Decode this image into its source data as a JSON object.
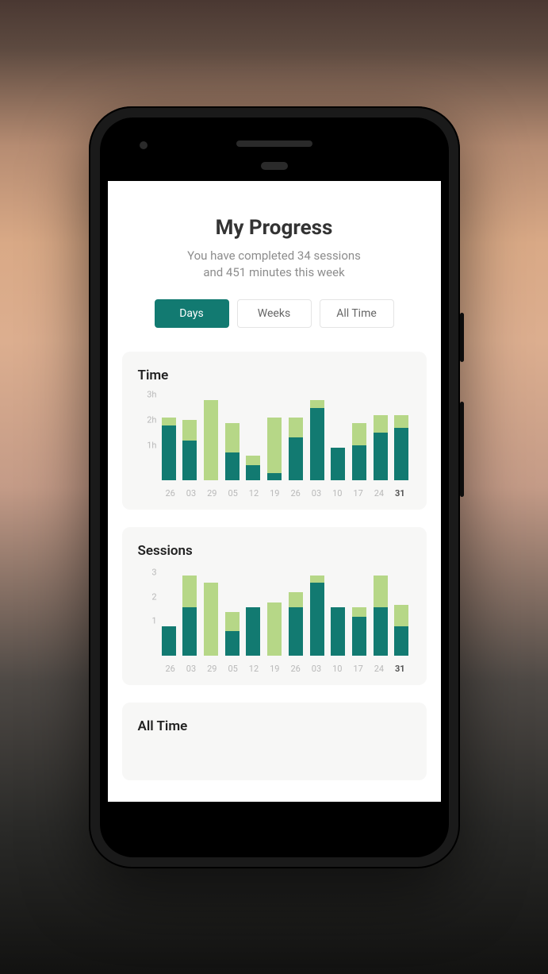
{
  "header": {
    "title": "My Progress",
    "subtitle_line1": "You have completed 34 sessions",
    "subtitle_line2": "and 451 minutes this week"
  },
  "segmented": {
    "items": [
      "Days",
      "Weeks",
      "All Time"
    ],
    "active_index": 0
  },
  "colors": {
    "light": "#b6d787",
    "dark": "#127a71",
    "card_bg": "#f7f7f6",
    "text_muted": "#b9b9b9"
  },
  "peek_card": {
    "title": "All Time"
  },
  "chart_data": [
    {
      "id": "time",
      "title": "Time",
      "type": "bar",
      "ylabel": "hours",
      "ylim": [
        0,
        3.3
      ],
      "yticks": [
        "1h",
        "2h",
        "3h"
      ],
      "ytick_values": [
        1,
        2,
        3
      ],
      "categories": [
        "26",
        "03",
        "29",
        "05",
        "12",
        "19",
        "26",
        "03",
        "10",
        "17",
        "24",
        "31"
      ],
      "highlight_index": 11,
      "series": [
        {
          "name": "dark",
          "color": "#127a71",
          "values": [
            2.2,
            1.6,
            0.0,
            1.1,
            0.6,
            0.3,
            1.7,
            2.9,
            1.3,
            1.4,
            1.9,
            2.1
          ]
        },
        {
          "name": "light",
          "color": "#b6d787",
          "values": [
            0.3,
            0.8,
            3.2,
            1.2,
            0.4,
            2.2,
            0.8,
            0.3,
            0.0,
            0.9,
            0.7,
            0.5
          ]
        }
      ]
    },
    {
      "id": "sessions",
      "title": "Sessions",
      "type": "bar",
      "ylabel": "sessions",
      "ylim": [
        0,
        3.4
      ],
      "yticks": [
        "1",
        "2",
        "3"
      ],
      "ytick_values": [
        1,
        2,
        3
      ],
      "categories": [
        "26",
        "03",
        "29",
        "05",
        "12",
        "19",
        "26",
        "03",
        "10",
        "17",
        "24",
        "31"
      ],
      "highlight_index": 11,
      "series": [
        {
          "name": "dark",
          "color": "#127a71",
          "values": [
            1.2,
            2.0,
            0.0,
            1.0,
            2.0,
            0.0,
            2.0,
            3.0,
            2.0,
            1.6,
            2.0,
            1.2
          ]
        },
        {
          "name": "light",
          "color": "#b6d787",
          "values": [
            0.0,
            1.3,
            3.0,
            0.8,
            0.0,
            2.2,
            0.6,
            0.3,
            0.0,
            0.4,
            1.3,
            0.9
          ]
        }
      ]
    }
  ]
}
